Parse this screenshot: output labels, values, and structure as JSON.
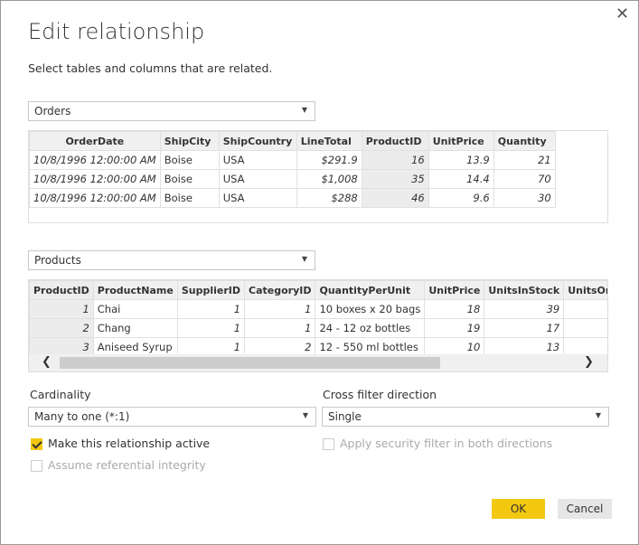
{
  "title": "Edit relationship",
  "subtitle": "Select tables and columns that are related.",
  "table1": {
    "selected": "Orders",
    "columns": [
      "OrderDate",
      "ShipCity",
      "ShipCountry",
      "LineTotal",
      "ProductID",
      "UnitPrice",
      "Quantity"
    ],
    "rows": [
      [
        "10/8/1996 12:00:00 AM",
        "Boise",
        "USA",
        "$291.9",
        "16",
        "13.9",
        "21"
      ],
      [
        "10/8/1996 12:00:00 AM",
        "Boise",
        "USA",
        "$1,008",
        "35",
        "14.4",
        "70"
      ],
      [
        "10/8/1996 12:00:00 AM",
        "Boise",
        "USA",
        "$288",
        "46",
        "9.6",
        "30"
      ]
    ]
  },
  "table2": {
    "selected": "Products",
    "columns": [
      "ProductID",
      "ProductName",
      "SupplierID",
      "CategoryID",
      "QuantityPerUnit",
      "UnitPrice",
      "UnitsInStock",
      "UnitsOnOrder"
    ],
    "rows": [
      [
        "1",
        "Chai",
        "1",
        "1",
        "10 boxes x 20 bags",
        "18",
        "39",
        ""
      ],
      [
        "2",
        "Chang",
        "1",
        "1",
        "24 - 12 oz bottles",
        "19",
        "17",
        ""
      ],
      [
        "3",
        "Aniseed Syrup",
        "1",
        "2",
        "12 - 550 ml bottles",
        "10",
        "13",
        ""
      ]
    ]
  },
  "cardinality": {
    "label": "Cardinality",
    "value": "Many to one (*:1)"
  },
  "crossfilter": {
    "label": "Cross filter direction",
    "value": "Single"
  },
  "options": {
    "active": "Make this relationship active",
    "referential": "Assume referential integrity",
    "security": "Apply security filter in both directions"
  },
  "buttons": {
    "ok": "OK",
    "cancel": "Cancel"
  },
  "colors": {
    "accent": "#f2c811"
  }
}
